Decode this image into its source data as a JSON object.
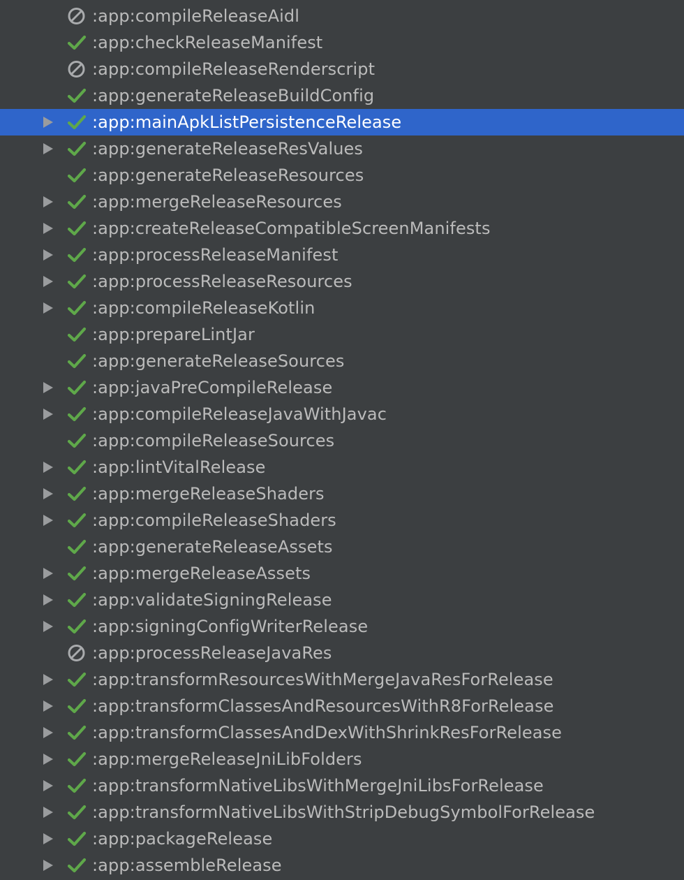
{
  "tree": {
    "selected_index": 4,
    "tasks": [
      {
        "label": ":app:compileReleaseAidl",
        "status": "skipped-icon",
        "expandable": false
      },
      {
        "label": ":app:checkReleaseManifest",
        "status": "success-check-icon",
        "expandable": false
      },
      {
        "label": ":app:compileReleaseRenderscript",
        "status": "skipped-icon",
        "expandable": false
      },
      {
        "label": ":app:generateReleaseBuildConfig",
        "status": "success-check-icon",
        "expandable": false
      },
      {
        "label": ":app:mainApkListPersistenceRelease",
        "status": "success-check-icon",
        "expandable": true
      },
      {
        "label": ":app:generateReleaseResValues",
        "status": "success-check-icon",
        "expandable": true
      },
      {
        "label": ":app:generateReleaseResources",
        "status": "success-check-icon",
        "expandable": false
      },
      {
        "label": ":app:mergeReleaseResources",
        "status": "success-check-icon",
        "expandable": true
      },
      {
        "label": ":app:createReleaseCompatibleScreenManifests",
        "status": "success-check-icon",
        "expandable": true
      },
      {
        "label": ":app:processReleaseManifest",
        "status": "success-check-icon",
        "expandable": true
      },
      {
        "label": ":app:processReleaseResources",
        "status": "success-check-icon",
        "expandable": true
      },
      {
        "label": ":app:compileReleaseKotlin",
        "status": "success-check-icon",
        "expandable": true
      },
      {
        "label": ":app:prepareLintJar",
        "status": "success-check-icon",
        "expandable": false
      },
      {
        "label": ":app:generateReleaseSources",
        "status": "success-check-icon",
        "expandable": false
      },
      {
        "label": ":app:javaPreCompileRelease",
        "status": "success-check-icon",
        "expandable": true
      },
      {
        "label": ":app:compileReleaseJavaWithJavac",
        "status": "success-check-icon",
        "expandable": true
      },
      {
        "label": ":app:compileReleaseSources",
        "status": "success-check-icon",
        "expandable": false
      },
      {
        "label": ":app:lintVitalRelease",
        "status": "success-check-icon",
        "expandable": true
      },
      {
        "label": ":app:mergeReleaseShaders",
        "status": "success-check-icon",
        "expandable": true
      },
      {
        "label": ":app:compileReleaseShaders",
        "status": "success-check-icon",
        "expandable": true
      },
      {
        "label": ":app:generateReleaseAssets",
        "status": "success-check-icon",
        "expandable": false
      },
      {
        "label": ":app:mergeReleaseAssets",
        "status": "success-check-icon",
        "expandable": true
      },
      {
        "label": ":app:validateSigningRelease",
        "status": "success-check-icon",
        "expandable": true
      },
      {
        "label": ":app:signingConfigWriterRelease",
        "status": "success-check-icon",
        "expandable": true
      },
      {
        "label": ":app:processReleaseJavaRes",
        "status": "skipped-icon",
        "expandable": false
      },
      {
        "label": ":app:transformResourcesWithMergeJavaResForRelease",
        "status": "success-check-icon",
        "expandable": true
      },
      {
        "label": ":app:transformClassesAndResourcesWithR8ForRelease",
        "status": "success-check-icon",
        "expandable": true
      },
      {
        "label": ":app:transformClassesAndDexWithShrinkResForRelease",
        "status": "success-check-icon",
        "expandable": true
      },
      {
        "label": ":app:mergeReleaseJniLibFolders",
        "status": "success-check-icon",
        "expandable": true
      },
      {
        "label": ":app:transformNativeLibsWithMergeJniLibsForRelease",
        "status": "success-check-icon",
        "expandable": true
      },
      {
        "label": ":app:transformNativeLibsWithStripDebugSymbolForRelease",
        "status": "success-check-icon",
        "expandable": true
      },
      {
        "label": ":app:packageRelease",
        "status": "success-check-icon",
        "expandable": true
      },
      {
        "label": ":app:assembleRelease",
        "status": "success-check-icon",
        "expandable": true
      }
    ]
  },
  "colors": {
    "background": "#3c3f41",
    "selection": "#2f65ca",
    "text": "#bbbbbb",
    "selected_text": "#ffffff",
    "success_green": "#5fa84a",
    "skipped_gray": "#a9abad",
    "expander_gray": "#9a9c9e"
  }
}
